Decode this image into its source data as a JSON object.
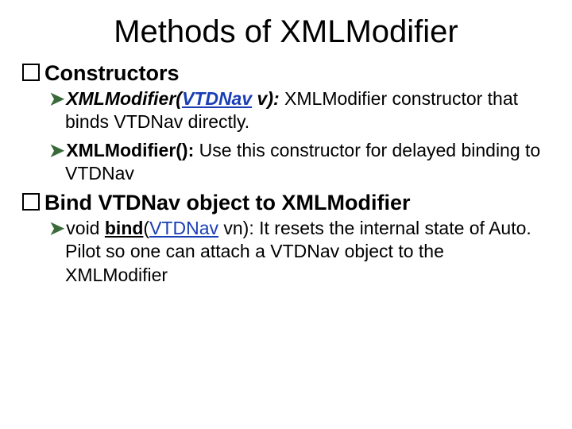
{
  "title": "Methods of XMLModifier",
  "section1": {
    "heading": "Constructors",
    "item1": {
      "sig_pre": "XMLModifier(",
      "sig_link": "VTDNav",
      "sig_post": " v): ",
      "desc": "XMLModifier constructor that binds VTDNav directly."
    },
    "item2": {
      "sig": "XMLModifier(): ",
      "desc": "Use this constructor for delayed binding to VTDNav"
    }
  },
  "section2": {
    "heading": "Bind VTDNav object to XMLModifier",
    "item1": {
      "ret": "void ",
      "method": "bind",
      "paren_open": "(",
      "arg_type": "VTDNav",
      "arg_rest": " vn): ",
      "desc": "It resets the internal state of Auto. Pilot so one can attach a VTDNav object to the XMLModifier"
    }
  }
}
